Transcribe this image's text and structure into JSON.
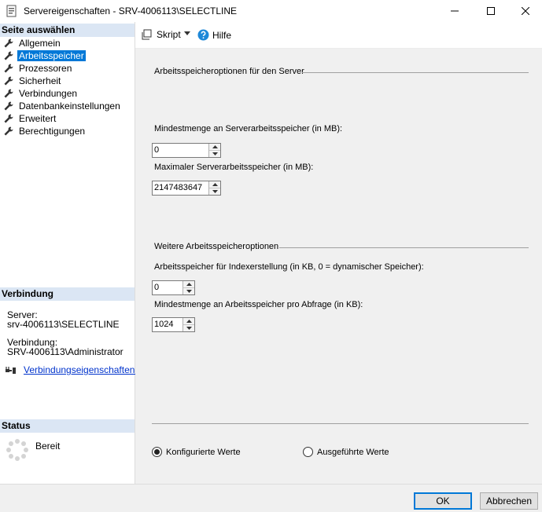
{
  "window": {
    "title": "Servereigenschaften - SRV-4006113\\SELECTLINE"
  },
  "left_pane": {
    "select_page_header": "Seite auswählen",
    "pages": [
      {
        "label": "Allgemein",
        "active": false
      },
      {
        "label": "Arbeitsspeicher",
        "active": true
      },
      {
        "label": "Prozessoren",
        "active": false
      },
      {
        "label": "Sicherheit",
        "active": false
      },
      {
        "label": "Verbindungen",
        "active": false
      },
      {
        "label": "Datenbankeinstellungen",
        "active": false
      },
      {
        "label": "Erweitert",
        "active": false
      },
      {
        "label": "Berechtigungen",
        "active": false
      }
    ],
    "connection_header": "Verbindung",
    "server_label": "Server:",
    "server_value": "srv-4006113\\SELECTLINE",
    "connection_label": "Verbindung:",
    "connection_value": "SRV-4006113\\Administrator",
    "connection_properties_link": "Verbindungseigenschaften anz",
    "status_header": "Status",
    "status_value": "Bereit"
  },
  "toolbar": {
    "script_label": "Skript",
    "help_label": "Hilfe"
  },
  "memory": {
    "server_group_label": "Arbeitsspeicheroptionen für den Server",
    "min_server_memory_label": "Mindestmenge an Serverarbeitsspeicher (in MB):",
    "min_server_memory_value": "0",
    "max_server_memory_label": "Maximaler Serverarbeitsspeicher (in MB):",
    "max_server_memory_value": "2147483647",
    "other_group_label": "Weitere Arbeitsspeicheroptionen",
    "index_memory_label": "Arbeitsspeicher für Indexerstellung (in KB, 0 = dynamischer Speicher):",
    "index_memory_value": "0",
    "min_query_memory_label": "Mindestmenge an Arbeitsspeicher pro Abfrage (in KB):",
    "min_query_memory_value": "1024"
  },
  "values_mode": {
    "configured_label": "Konfigurierte Werte",
    "running_label": "Ausgeführte Werte",
    "selected": "configured"
  },
  "footer": {
    "ok_label": "OK",
    "cancel_label": "Abbrechen"
  },
  "colors": {
    "selection": "#0078d7",
    "section_header": "#dbe6f4",
    "link": "#0033cc",
    "help_icon": "#1e88d8"
  },
  "icons": {
    "app": "server-properties-icon",
    "page": "wrench-icon",
    "script": "script-icon",
    "help": "help-icon",
    "connection": "plug-icon",
    "status": "spinner-icon"
  }
}
